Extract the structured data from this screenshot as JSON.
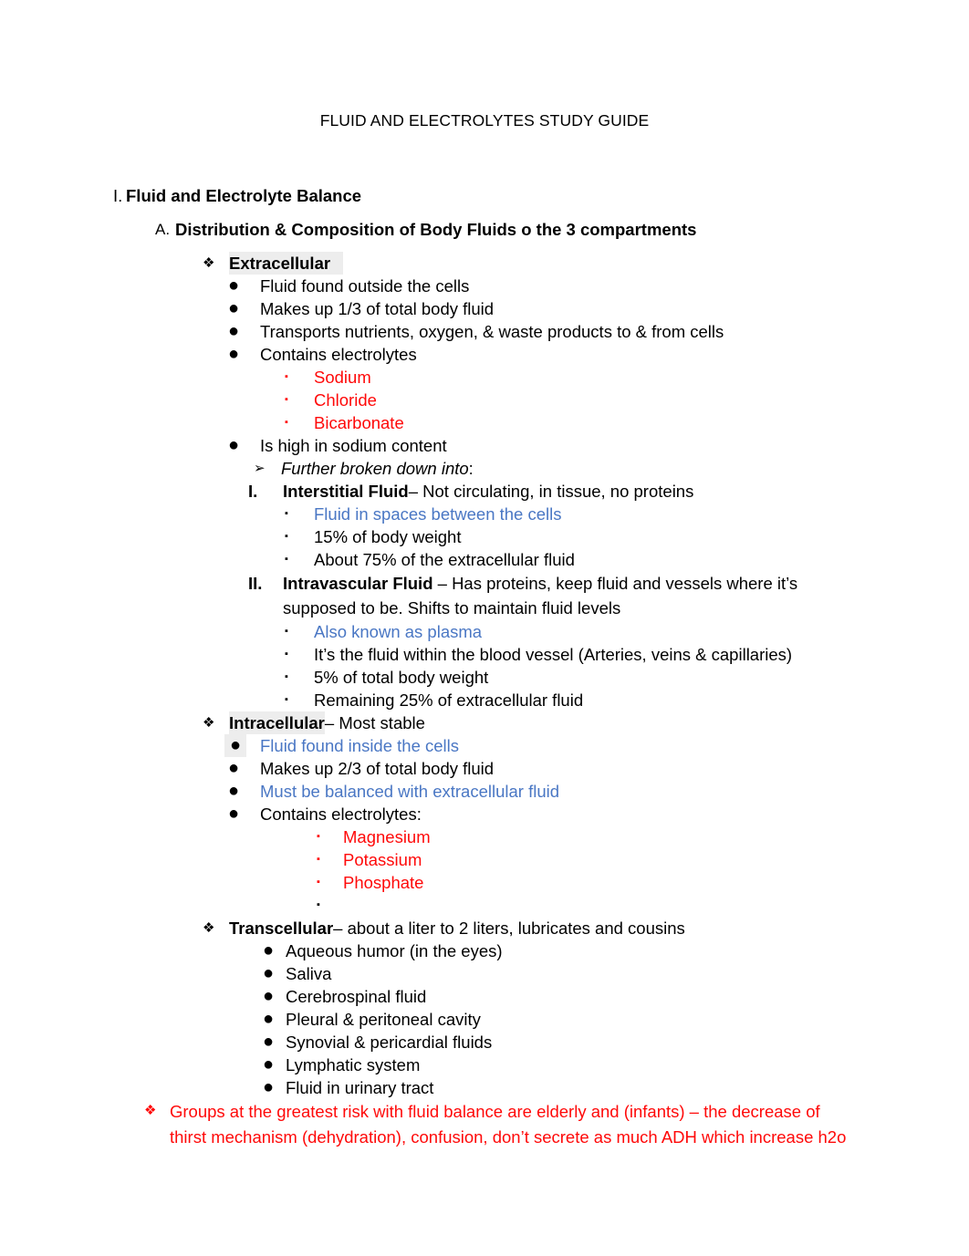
{
  "document": {
    "title": "FLUID AND ELECTROLYTES STUDY GUIDE",
    "colors": {
      "red": "#ff0909",
      "blue": "#4a77c4",
      "highlight": "#ededed",
      "text": "#000000"
    }
  },
  "markers": {
    "diamond": "❖",
    "dot": "●",
    "square": "▪",
    "arrow": "➢",
    "roman_1": "I.",
    "roman_2": "II.",
    "section_1": "I.",
    "sub_A": "A."
  },
  "outline": {
    "section_heading": "Fluid and Electrolyte Balance",
    "subsection_A": "Distribution & Composition of Body Fluids o the 3 compartments",
    "extracellular": {
      "heading": "Extracellular",
      "bullets": [
        "Fluid found outside the cells",
        "Makes up 1/3 of total body fluid",
        "Transports nutrients, oxygen, & waste products to & from cells",
        "Contains electrolytes"
      ],
      "electrolytes": [
        "Sodium",
        "Chloride",
        "Bicarbonate"
      ],
      "sodium_note": "Is high in sodium content",
      "further": "Further broken down into",
      "further_colon": ":",
      "interstitial": {
        "label": "Interstitial Fluid",
        "description": " – Not circulating, in tissue, no proteins",
        "bullets": [
          "Fluid in spaces between the cells",
          "15% of body weight",
          "About 75% of the extracellular fluid"
        ]
      },
      "intravascular": {
        "label": "Intravascular Fluid",
        "description": " – Has proteins, keep fluid and vessels where it’s supposed to be. Shifts to maintain fluid levels",
        "bullets": [
          "Also known as plasma",
          "It’s the fluid within the blood vessel (Arteries, veins & capillaries)",
          "5% of total body weight",
          "Remaining 25% of extracellular fluid"
        ]
      }
    },
    "intracellular": {
      "heading": "Intracellular",
      "heading_suffix": " – Most stable",
      "bullets": [
        "Fluid found inside the cells",
        "Makes up 2/3 of total body fluid",
        "Must be balanced with extracellular fluid",
        "Contains electrolytes:"
      ],
      "electrolytes": [
        "Magnesium",
        "Potassium",
        "Phosphate",
        ""
      ]
    },
    "transcellular": {
      "heading": "Transcellular",
      "heading_suffix": " – about a liter to 2 liters, lubricates and cousins",
      "bullets": [
        "Aqueous humor (in the eyes)",
        "Saliva",
        "Cerebrospinal fluid",
        "Pleural & peritoneal cavity",
        "Synovial & pericardial fluids",
        "Lymphatic system",
        "Fluid in urinary tract"
      ]
    },
    "risk_note": "Groups at the greatest risk with fluid balance are elderly and (infants) – the decrease of thirst mechanism (dehydration), confusion, don’t secrete as much ADH which increase h2o"
  }
}
